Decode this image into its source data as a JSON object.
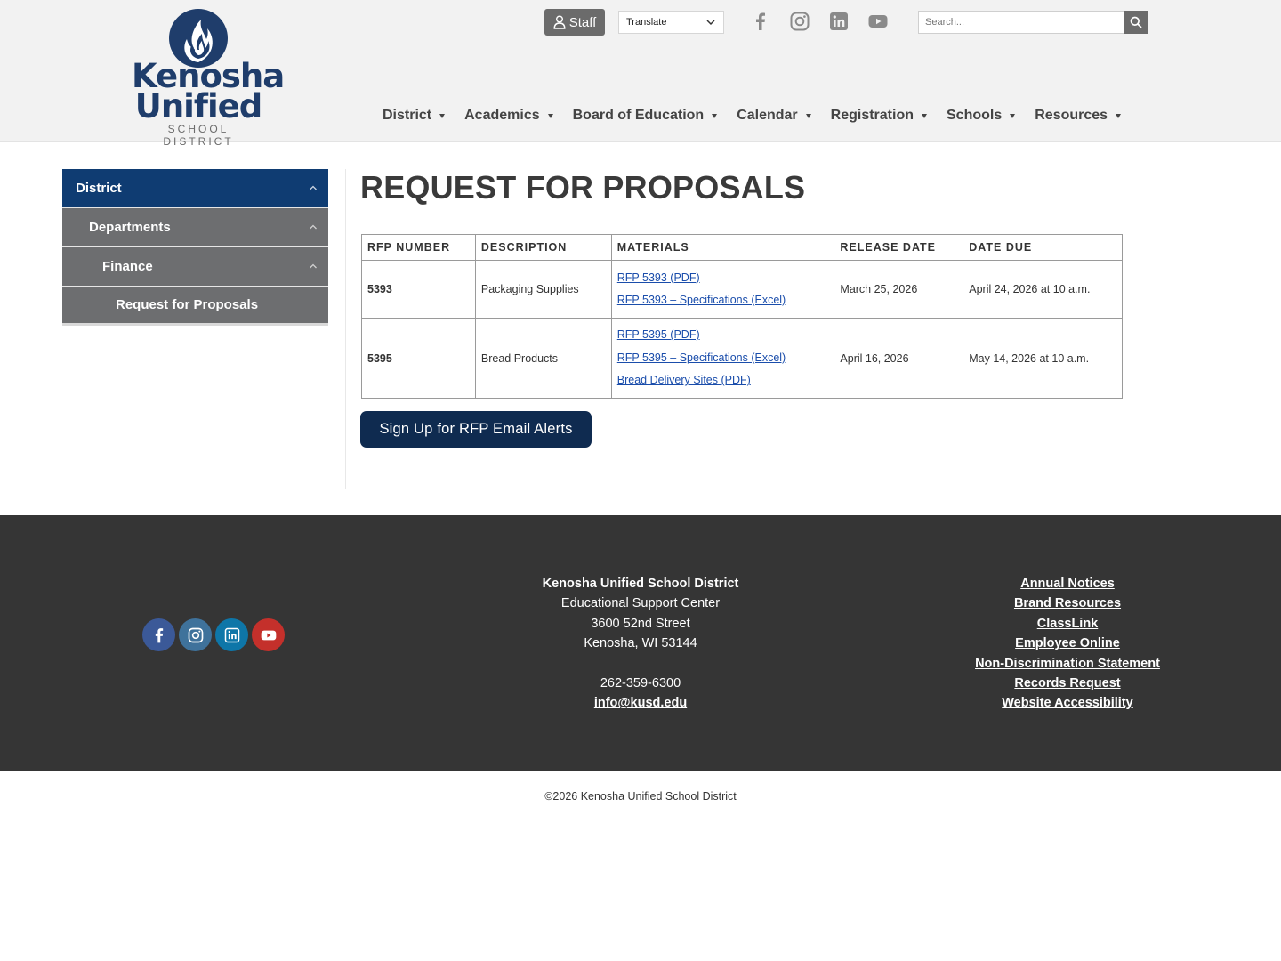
{
  "logo": {
    "line1": "Kenosha",
    "line2": "Unified",
    "line3": "SCHOOL DISTRICT"
  },
  "topbar": {
    "staff_label": "Staff",
    "translate_label": "Translate",
    "search_placeholder": "Search..."
  },
  "nav": [
    {
      "label": "District"
    },
    {
      "label": "Academics"
    },
    {
      "label": "Board of Education"
    },
    {
      "label": "Calendar"
    },
    {
      "label": "Registration"
    },
    {
      "label": "Schools"
    },
    {
      "label": "Resources"
    }
  ],
  "sidebar": {
    "items": [
      {
        "label": "District"
      },
      {
        "label": "Departments"
      },
      {
        "label": "Finance"
      },
      {
        "label": "Request for Proposals"
      }
    ]
  },
  "main": {
    "title": "REQUEST FOR PROPOSALS",
    "table": {
      "headers": [
        "RFP NUMBER",
        "DESCRIPTION",
        "MATERIALS",
        "RELEASE DATE",
        "DATE DUE"
      ],
      "rows": [
        {
          "number": "5393",
          "description": "Packaging Supplies",
          "materials": [
            "RFP 5393 (PDF)",
            "RFP 5393 – Specifications (Excel)"
          ],
          "release": "March 25, 2026",
          "due": "April 24, 2026 at 10 a.m."
        },
        {
          "number": "5395",
          "description": "Bread Products",
          "materials": [
            "RFP 5395 (PDF)",
            "RFP 5395 – Specifications (Excel)",
            "Bread Delivery Sites (PDF)"
          ],
          "release": "April 16, 2026",
          "due": "May 14, 2026 at 10 a.m."
        }
      ]
    },
    "cta_label": "Sign Up for RFP Email Alerts"
  },
  "footer": {
    "org_name": "Kenosha Unified School District",
    "address_lines": [
      "Educational Support Center",
      "3600 52nd Street",
      "Kenosha, WI 53144"
    ],
    "phone": "262-359-6300",
    "email": "info@kusd.edu",
    "links": [
      "Annual Notices",
      "Brand Resources",
      "ClassLink",
      "Employee Online",
      "Non-Discrimination Statement",
      "Records Request",
      "Website Accessibility"
    ],
    "social": [
      "facebook-icon",
      "instagram-icon",
      "linkedin-icon",
      "youtube-icon"
    ]
  },
  "copyright": "©2026 Kenosha Unified School District",
  "colors": {
    "brand_navy": "#0f3c72",
    "cta_navy": "#0f2b50",
    "sidebar_gray": "#6d6e70",
    "footer_bg": "#353535",
    "link_blue": "#1a4dab",
    "facebook": "#3b5998",
    "instagram": "#3f729b",
    "linkedin": "#0e76a8",
    "youtube": "#c4302b"
  }
}
